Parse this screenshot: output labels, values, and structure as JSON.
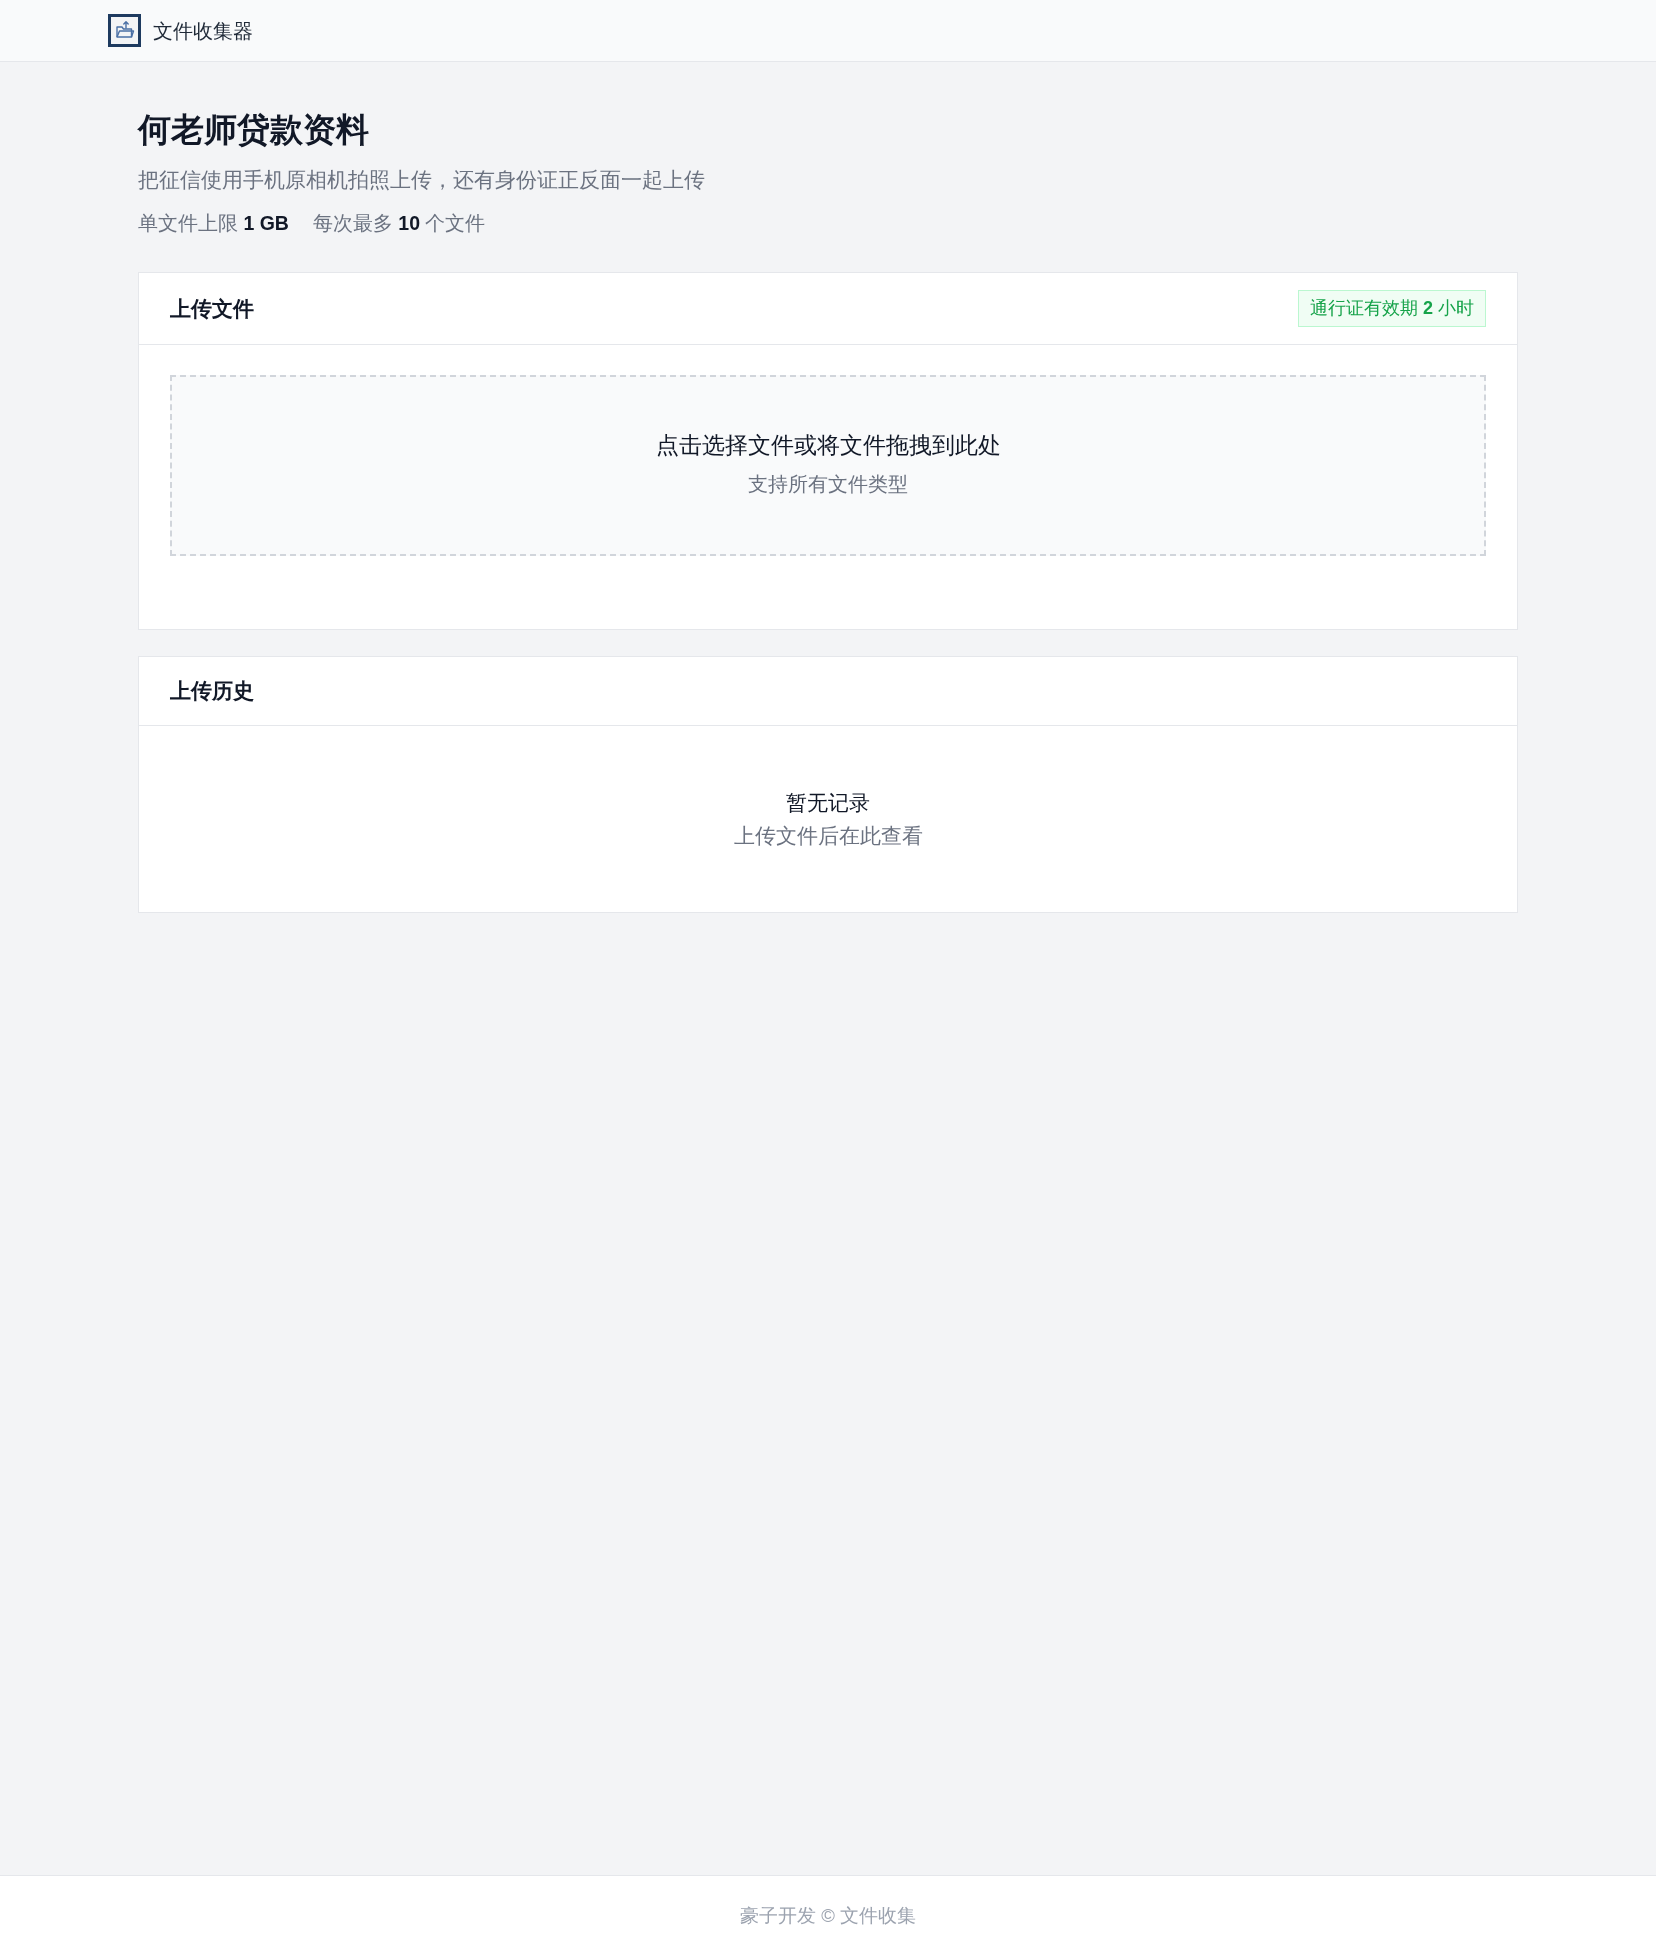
{
  "header": {
    "app_name": "文件收集器"
  },
  "page": {
    "title": "何老师贷款资料",
    "description": "把征信使用手机原相机拍照上传，还有身份证正反面一起上传",
    "limits": [
      "单文件上限 **1 GB**",
      "每次最多 **10** 个文件"
    ]
  },
  "upload_card": {
    "title": "上传文件",
    "badge": "通行证有效期 **2** 小时",
    "dropzone": {
      "prompt": "点击选择文件或将文件拖拽到此处",
      "hint": "支持所有文件类型"
    }
  },
  "history_card": {
    "title": "上传历史",
    "empty_state": {
      "title": "暂无记录",
      "hint": "上传文件后在此查看"
    }
  },
  "footer": {
    "text": "豪子开发 © 文件收集"
  }
}
